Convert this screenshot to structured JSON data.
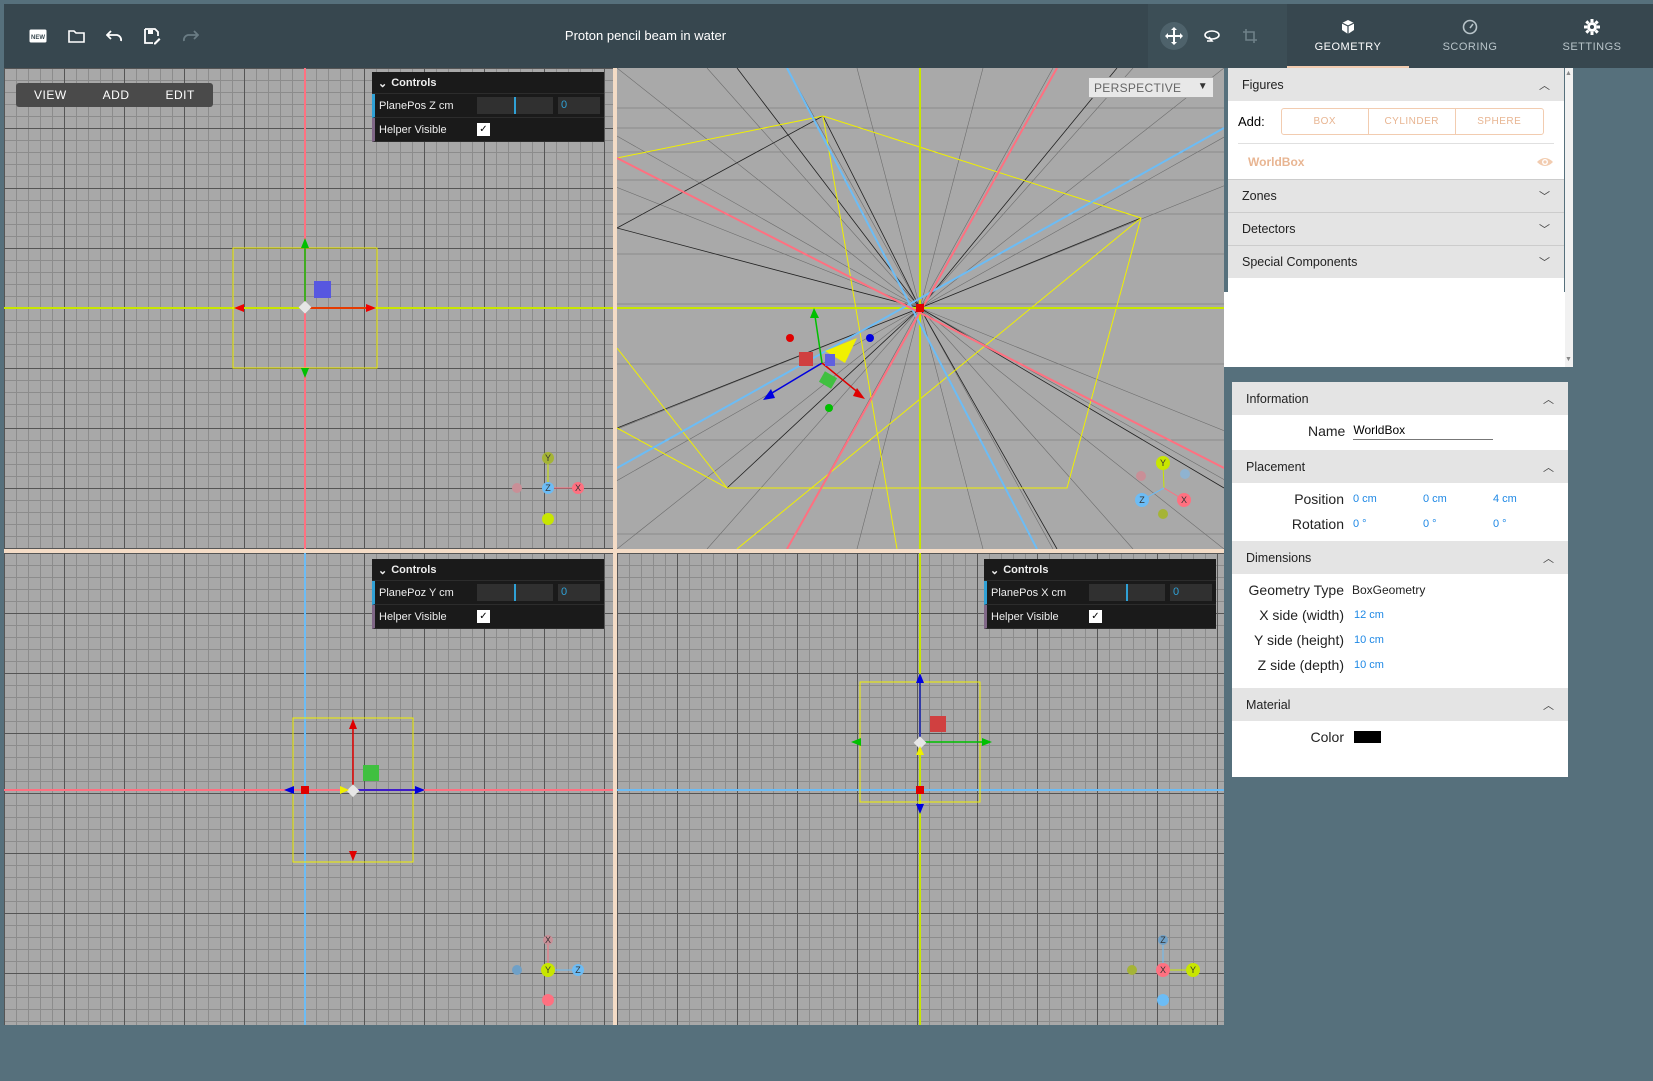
{
  "toolbar": {
    "title": "Proton pencil beam in water",
    "left_icons": [
      "new-icon",
      "open-folder-icon",
      "undo-icon",
      "save-icon",
      "redo-icon"
    ],
    "right_icons": [
      "move-icon",
      "rotate-icon",
      "scale-icon"
    ]
  },
  "tabs": [
    {
      "label": "GEOMETRY",
      "icon": "cube-icon",
      "active": true
    },
    {
      "label": "SCORING",
      "icon": "gauge-icon",
      "active": false
    },
    {
      "label": "SETTINGS",
      "icon": "gear-icon",
      "active": false
    }
  ],
  "view_menu": {
    "view": "VIEW",
    "add": "ADD",
    "edit": "EDIT"
  },
  "perspective": {
    "value": "PERSPECTIVE"
  },
  "controls": {
    "z": {
      "title": "Controls",
      "slider_label": "PlanePos Z cm",
      "value": "0",
      "helper_label": "Helper Visible",
      "helper_checked": true
    },
    "y": {
      "title": "Controls",
      "slider_label": "PlanePoz Y cm",
      "value": "0",
      "helper_label": "Helper Visible",
      "helper_checked": true
    },
    "x": {
      "title": "Controls",
      "slider_label": "PlanePos X cm",
      "value": "0",
      "helper_label": "Helper Visible",
      "helper_checked": true
    }
  },
  "axes_labels": {
    "x": "X",
    "y": "Y",
    "z": "Z"
  },
  "colors": {
    "x_axis": "#ff7080",
    "y_axis": "#c8e600",
    "z_axis": "#6cbcf5",
    "accent": "#e8b592",
    "link": "#1e88e5"
  },
  "figures_panel": {
    "title": "Figures",
    "add_label": "Add:",
    "add_buttons": [
      "BOX",
      "CYLINDER",
      "SPHERE"
    ],
    "worldbox": "WorldBox",
    "sections": [
      "Zones",
      "Detectors",
      "Special Components"
    ]
  },
  "properties": {
    "information": {
      "title": "Information",
      "name_label": "Name",
      "name_value": "WorldBox"
    },
    "placement": {
      "title": "Placement",
      "position_label": "Position",
      "position": [
        "0 cm",
        "0 cm",
        "4 cm"
      ],
      "rotation_label": "Rotation",
      "rotation": [
        "0 °",
        "0 °",
        "0 °"
      ]
    },
    "dimensions": {
      "title": "Dimensions",
      "type_label": "Geometry Type",
      "type_value": "BoxGeometry",
      "x_label": "X side (width)",
      "x_value": "12 cm",
      "y_label": "Y side (height)",
      "y_value": "10 cm",
      "z_label": "Z side (depth)",
      "z_value": "10 cm"
    },
    "material": {
      "title": "Material",
      "color_label": "Color",
      "color": "#000000"
    }
  }
}
